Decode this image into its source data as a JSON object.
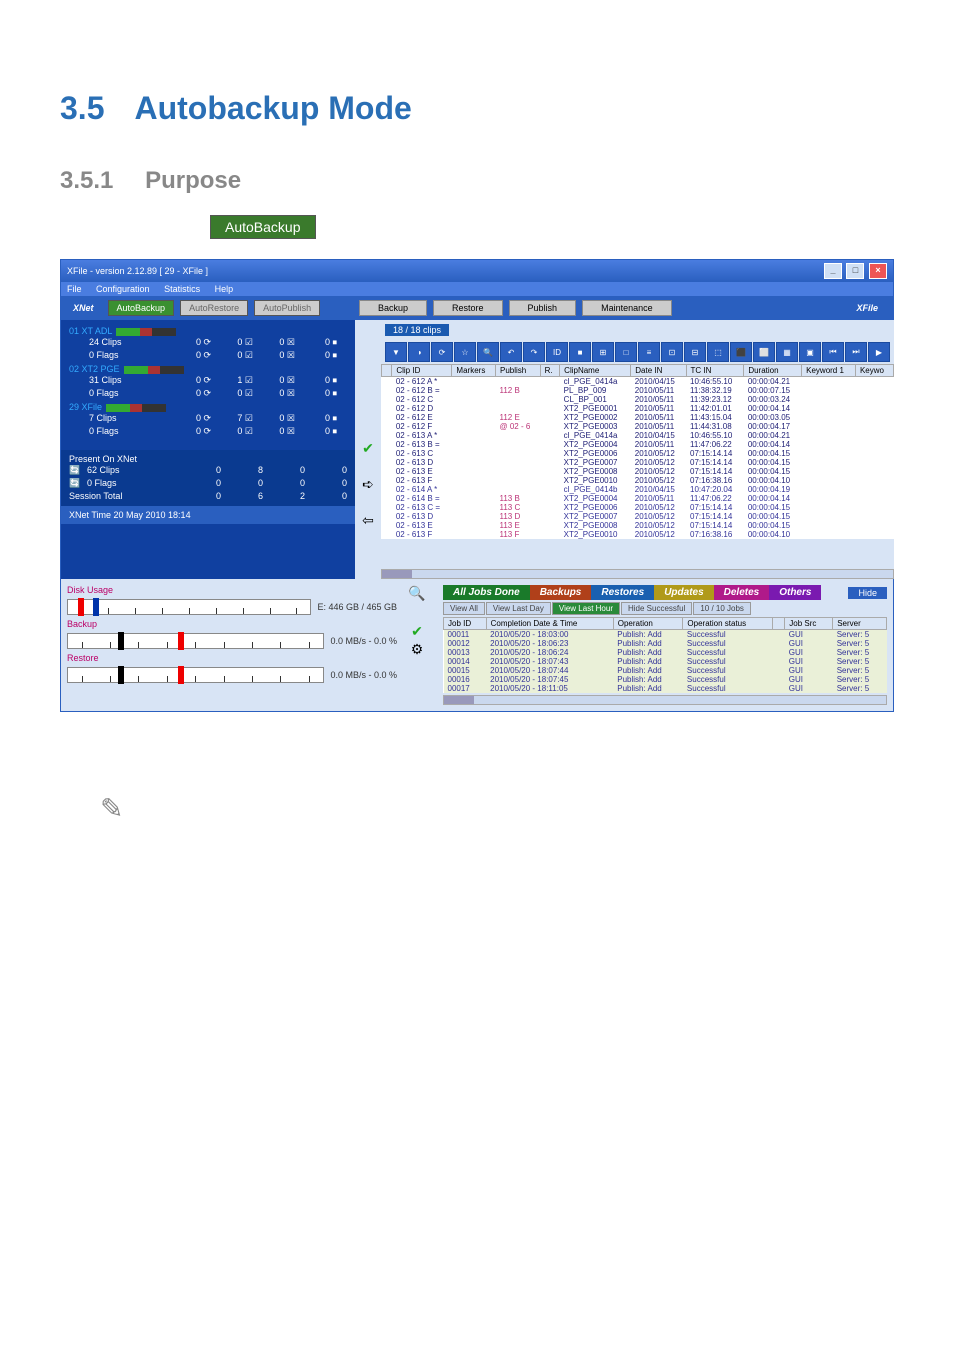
{
  "section": {
    "num": "3.5",
    "title": "Autobackup Mode"
  },
  "sub": {
    "num": "3.5.1",
    "title": "Purpose"
  },
  "btn_auto": "AutoBackup",
  "win": {
    "title": "XFile - version 2.12.89 [ 29 - XFile ]"
  },
  "menu": [
    "File",
    "Configuration",
    "Statistics",
    "Help"
  ],
  "xnet": "XNet",
  "leftTabs": [
    "AutoBackup",
    "AutoRestore",
    "AutoPublish"
  ],
  "servers": [
    {
      "name": "01 XT ADL",
      "rows": [
        [
          "24 Clips",
          "0",
          "0",
          "0",
          "0"
        ],
        [
          "0 Flags",
          "0",
          "0",
          "0",
          "0"
        ]
      ]
    },
    {
      "name": "02 XT2 PGE",
      "rows": [
        [
          "31 Clips",
          "0",
          "1",
          "0",
          "0"
        ],
        [
          "0 Flags",
          "0",
          "0",
          "0",
          "0"
        ]
      ]
    },
    {
      "name": "29 XFile",
      "rows": [
        [
          "7 Clips",
          "0",
          "7",
          "0",
          "0"
        ],
        [
          "0 Flags",
          "0",
          "0",
          "0",
          "0"
        ]
      ]
    }
  ],
  "present": {
    "title": "Present On XNet",
    "rows": [
      [
        "62 Clips",
        "0",
        "8",
        "0",
        "0"
      ],
      [
        "0 Flags",
        "0",
        "0",
        "0",
        "0"
      ]
    ]
  },
  "session": [
    "Session Total",
    "0",
    "6",
    "2",
    "0"
  ],
  "xnetTime": "XNet Time     20 May 2010   18:14",
  "topBtns": [
    "Backup",
    "Restore",
    "Publish",
    "Maintenance"
  ],
  "xfile": "XFile",
  "clipCount": "18 / 18 clips",
  "clipCols": [
    "",
    "Clip ID",
    "Markers",
    "Publish",
    "R.",
    "ClipName",
    "Date IN",
    "TC IN",
    "Duration",
    "Keyword 1",
    "Keywo"
  ],
  "clips": [
    [
      "02 - 612 A *",
      "",
      "",
      "",
      "cl_PGE_0414a",
      "2010/04/15",
      "10:46:55.10",
      "00:00:04.21"
    ],
    [
      "02 - 612 B =",
      "",
      "112 B",
      "",
      "PL_BP_009",
      "2010/05/11",
      "11:38:32.19",
      "00:00:07.15"
    ],
    [
      "02 - 612 C",
      "",
      "",
      "",
      "CL_BP_001",
      "2010/05/11",
      "11:39:23.12",
      "00:00:03.24"
    ],
    [
      "02 - 612 D",
      "",
      "",
      "",
      "XT2_PGE0001",
      "2010/05/11",
      "11:42:01.01",
      "00:00:04.14"
    ],
    [
      "02 - 612 E",
      "",
      "112 E",
      "",
      "XT2_PGE0002",
      "2010/05/11",
      "11:43:15.04",
      "00:00:03.05"
    ],
    [
      "02 - 612 F",
      "",
      "@ 02 - 6",
      "",
      "XT2_PGE0003",
      "2010/05/11",
      "11:44:31.08",
      "00:00:04.17"
    ],
    [
      "02 - 613 A *",
      "",
      "",
      "",
      "cl_PGE_0414a",
      "2010/04/15",
      "10:46:55.10",
      "00:00:04.21"
    ],
    [
      "02 - 613 B =",
      "",
      "",
      "",
      "XT2_PGE0004",
      "2010/05/11",
      "11:47:06.22",
      "00:00:04.14"
    ],
    [
      "02 - 613 C",
      "",
      "",
      "",
      "XT2_PGE0006",
      "2010/05/12",
      "07:15:14.14",
      "00:00:04.15"
    ],
    [
      "02 - 613 D",
      "",
      "",
      "",
      "XT2_PGE0007",
      "2010/05/12",
      "07:15:14.14",
      "00:00:04.15"
    ],
    [
      "02 - 613 E",
      "",
      "",
      "",
      "XT2_PGE0008",
      "2010/05/12",
      "07:15:14.14",
      "00:00:04.15"
    ],
    [
      "02 - 613 F",
      "",
      "",
      "",
      "XT2_PGE0010",
      "2010/05/12",
      "07:16:38.16",
      "00:00:04.10"
    ],
    [
      "02 - 614 A *",
      "",
      "",
      "",
      "cl_PGE_0414b",
      "2010/04/15",
      "10:47:20.04",
      "00:00:04.19"
    ],
    [
      "02 - 614 B =",
      "",
      "113 B",
      "",
      "XT2_PGE0004",
      "2010/05/11",
      "11:47:06.22",
      "00:00:04.14"
    ],
    [
      "02 - 613 C =",
      "",
      "113 C",
      "",
      "XT2_PGE0006",
      "2010/05/12",
      "07:15:14.14",
      "00:00:04.15"
    ],
    [
      "02 - 613 D",
      "",
      "113 D",
      "",
      "XT2_PGE0007",
      "2010/05/12",
      "07:15:14.14",
      "00:00:04.15"
    ],
    [
      "02 - 613 E",
      "",
      "113 E",
      "",
      "XT2_PGE0008",
      "2010/05/12",
      "07:15:14.14",
      "00:00:04.15"
    ],
    [
      "02 - 613 F",
      "",
      "113 F",
      "",
      "XT2_PGE0010",
      "2010/05/12",
      "07:16:38.16",
      "00:00:04.10"
    ]
  ],
  "disk": {
    "title": "Disk Usage",
    "backup": "Backup",
    "restore": "Restore",
    "e": "E: 446 GB / 465 GB",
    "rate": "0.0 MB/s - 0.0 %"
  },
  "jobTabs": [
    "All Jobs Done",
    "Backups",
    "Restores",
    "Updates",
    "Deletes",
    "Others"
  ],
  "filters": [
    "View All",
    "View Last Day",
    "View Last Hour",
    "Hide Successful",
    "10 / 10 Jobs"
  ],
  "hide": "Hide",
  "jobCols": [
    "Job ID",
    "Completion Date & Time",
    "Operation",
    "Operation status",
    "",
    "Job Src",
    "Server"
  ],
  "jobs": [
    [
      "00011",
      "2010/05/20 - 18:03:00",
      "Publish: Add",
      "Successful",
      "",
      "GUI",
      "Server: 5"
    ],
    [
      "00012",
      "2010/05/20 - 18:06:23",
      "Publish: Add",
      "Successful",
      "",
      "GUI",
      "Server: 5"
    ],
    [
      "00013",
      "2010/05/20 - 18:06:24",
      "Publish: Add",
      "Successful",
      "",
      "GUI",
      "Server: 5"
    ],
    [
      "00014",
      "2010/05/20 - 18:07:43",
      "Publish: Add",
      "Successful",
      "",
      "GUI",
      "Server: 5"
    ],
    [
      "00015",
      "2010/05/20 - 18:07:44",
      "Publish: Add",
      "Successful",
      "",
      "GUI",
      "Server: 5"
    ],
    [
      "00016",
      "2010/05/20 - 18:07:45",
      "Publish: Add",
      "Successful",
      "",
      "GUI",
      "Server: 5"
    ],
    [
      "00017",
      "2010/05/20 - 18:11:05",
      "Publish: Add",
      "Successful",
      "",
      "GUI",
      "Server: 5"
    ]
  ]
}
